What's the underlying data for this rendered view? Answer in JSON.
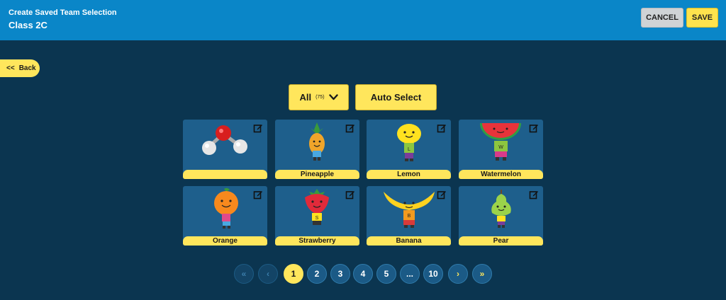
{
  "header": {
    "subtitle": "Create Saved Team Selection",
    "title": "Class 2C",
    "cancel_label": "CANCEL",
    "save_label": "SAVE"
  },
  "back": {
    "label": "Back",
    "icon": "<<"
  },
  "toolbar": {
    "filter_label": "All",
    "filter_count": "(75)",
    "auto_select_label": "Auto Select"
  },
  "cards": [
    {
      "name": "",
      "character": "water-molecule"
    },
    {
      "name": "Pineapple",
      "character": "pineapple"
    },
    {
      "name": "Lemon",
      "character": "lemon"
    },
    {
      "name": "Watermelon",
      "character": "watermelon"
    },
    {
      "name": "Orange",
      "character": "orange"
    },
    {
      "name": "Strawberry",
      "character": "strawberry"
    },
    {
      "name": "Banana",
      "character": "banana"
    },
    {
      "name": "Pear",
      "character": "pear"
    }
  ],
  "pagination": {
    "first": "«",
    "prev": "‹",
    "pages": [
      "1",
      "2",
      "3",
      "4",
      "5",
      "...",
      "10"
    ],
    "current": "1",
    "next": "›",
    "last": "»"
  },
  "colors": {
    "background": "#0b3550",
    "header": "#0a86c8",
    "accent": "#ffe65c",
    "card": "#1e5f8c"
  }
}
